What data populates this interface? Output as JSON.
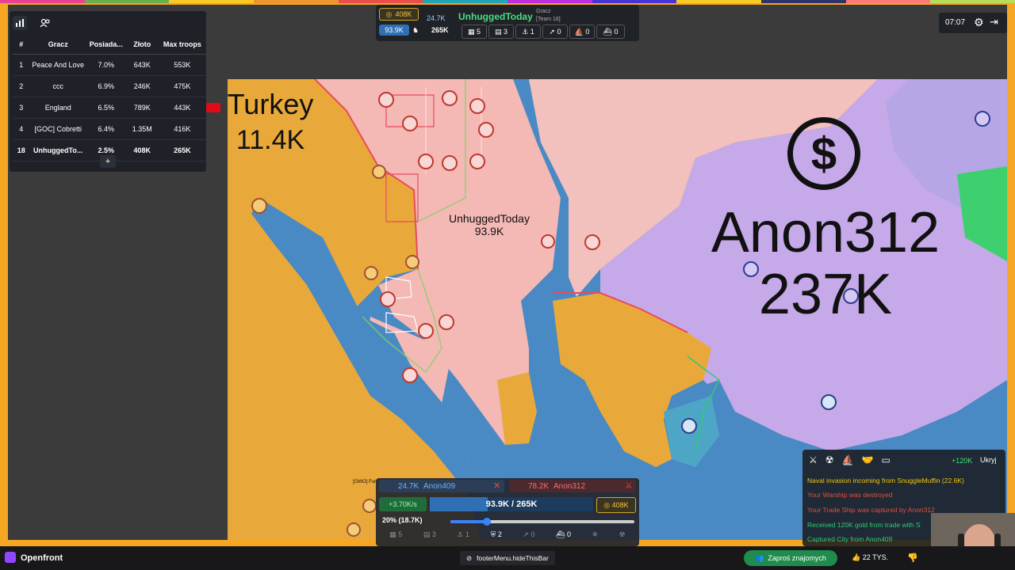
{
  "leaderboard": {
    "headers": [
      "#",
      "Gracz",
      "Posiada...",
      "Złoto",
      "Max troops"
    ],
    "rows": [
      {
        "rank": "1",
        "name": "Peace And Love",
        "share": "7.0%",
        "gold": "643K",
        "troops": "553K"
      },
      {
        "rank": "2",
        "name": "ccc",
        "share": "6.9%",
        "gold": "246K",
        "troops": "475K"
      },
      {
        "rank": "3",
        "name": "England",
        "share": "6.5%",
        "gold": "789K",
        "troops": "443K"
      },
      {
        "rank": "4",
        "name": "[GOC] Cobretti",
        "share": "6.4%",
        "gold": "1.35M",
        "troops": "416K"
      },
      {
        "rank": "18",
        "name": "UnhuggedTo...",
        "share": "2.5%",
        "gold": "408K",
        "troops": "265K"
      }
    ],
    "add_label": "+"
  },
  "topbar": {
    "gold": "408K",
    "population": "24.7K",
    "player_name": "UnhuggedToday",
    "player_label": "Gracz",
    "team": "[Team 18]",
    "troops": "93.9K",
    "max_troops": "265K",
    "cities": "5",
    "factories": "3",
    "ports": "1",
    "missiles": "0",
    "warships": "0",
    "boats": "0"
  },
  "timer": "07:07",
  "map_labels": {
    "turkey_name": "Turkey",
    "turkey_troops": "11.4K",
    "self_name": "UnhuggedToday",
    "self_troops": "93.9K",
    "anon_name": "Anon312",
    "anon_troops": "237K",
    "owo_label": "[OWO] Fur..."
  },
  "control": {
    "attack1_troops": "24.7K",
    "attack1_name": "Anon409",
    "attack2_troops": "78.2K",
    "attack2_name": "Anon312",
    "rate": "+3.70K/s",
    "troops_display": "93.9K / 265K",
    "gold": "408K",
    "attack_ratio": "20% (18.7K)",
    "attack_ratio_value": 0.2,
    "units": [
      "5",
      "3",
      "1",
      "2",
      "0",
      "0"
    ]
  },
  "events": {
    "gold_income": "+120K",
    "hide_label": "Ukryj",
    "messages": [
      {
        "text": "Naval invasion incoming from SnuggleMuffin (22.6K)",
        "color": "#f1c40f"
      },
      {
        "text": "Your Warship was destroyed",
        "color": "#e74c3c"
      },
      {
        "text": "Your Trade Ship was captured by Anon312",
        "color": "#e74c3c"
      },
      {
        "text": "Received 120K gold from trade with S",
        "color": "#2ecc71"
      },
      {
        "text": "Captured City from Anon409",
        "color": "#2ecc71"
      }
    ]
  },
  "footer": {
    "channel": "Openfront",
    "center_label": "footerMenu.hideThisBar",
    "invite_label": "Zaproś znajomych",
    "likes": "22 TYS."
  },
  "colors": {
    "self_territory": "#f4b8b5",
    "ally_territory": "#e8a93a",
    "anon_territory": "#c6a9e8",
    "water": "#4a8ac4",
    "twitch_purple": "#9147ff",
    "invite_green": "#1f8b4c"
  }
}
